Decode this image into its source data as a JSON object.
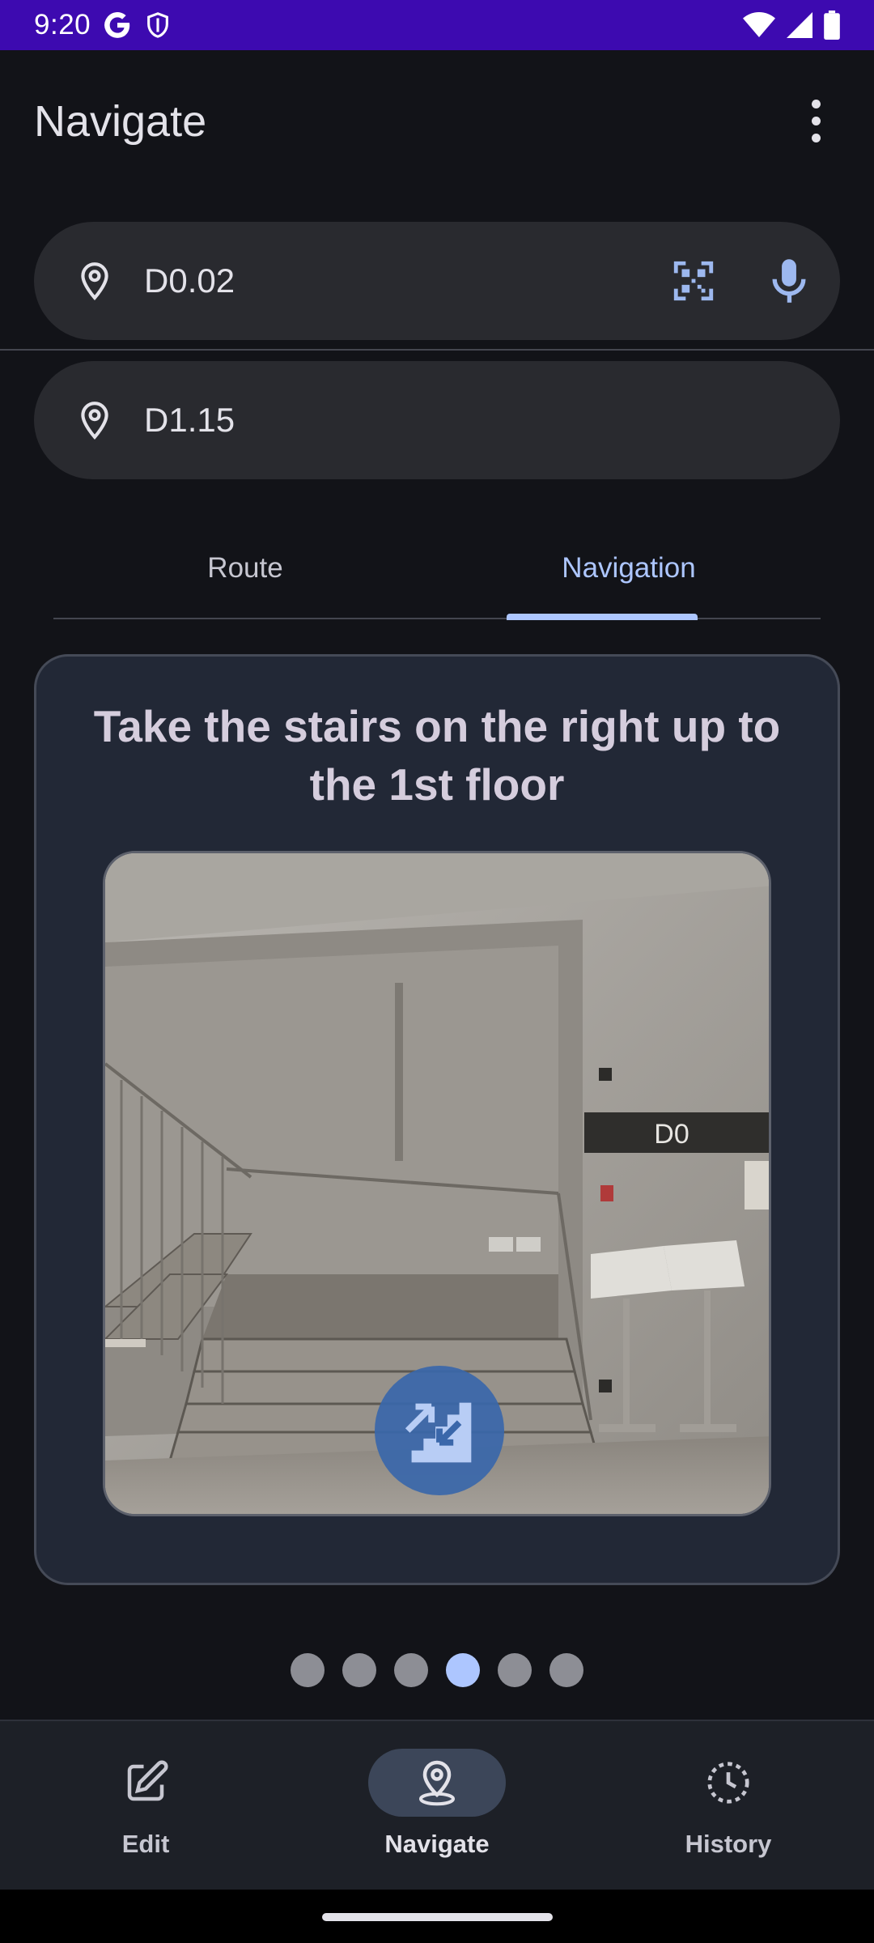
{
  "status_bar": {
    "time": "9:20",
    "left_icons": [
      "google-icon",
      "shield-icon"
    ],
    "right_icons": [
      "wifi-icon",
      "signal-icon",
      "battery-icon"
    ],
    "color": "#3d0ab0"
  },
  "app_bar": {
    "title": "Navigate",
    "menu_icon": "more-vert-icon"
  },
  "origin": {
    "icon": "location-pin-icon",
    "value": "D0.02",
    "actions": [
      "qr-code-scan-icon",
      "microphone-icon"
    ]
  },
  "destination": {
    "icon": "location-pin-icon",
    "value": "D1.15"
  },
  "tabs": [
    {
      "label": "Route",
      "selected": false
    },
    {
      "label": "Navigation",
      "selected": true
    }
  ],
  "step_card": {
    "instruction": "Take the stairs on the right up to the 1st floor",
    "photo_sign_text": "D0",
    "badge_icon": "stairs-icon"
  },
  "pager": {
    "total": 6,
    "current": 4
  },
  "bottom_nav": {
    "items": [
      {
        "label": "Edit",
        "icon": "edit-icon",
        "selected": false
      },
      {
        "label": "Navigate",
        "icon": "navigate-pin-icon",
        "selected": true
      },
      {
        "label": "History",
        "icon": "history-icon",
        "selected": false
      }
    ]
  },
  "colors": {
    "background": "#121318",
    "accent": "#adc6ff",
    "card": "#222836"
  }
}
